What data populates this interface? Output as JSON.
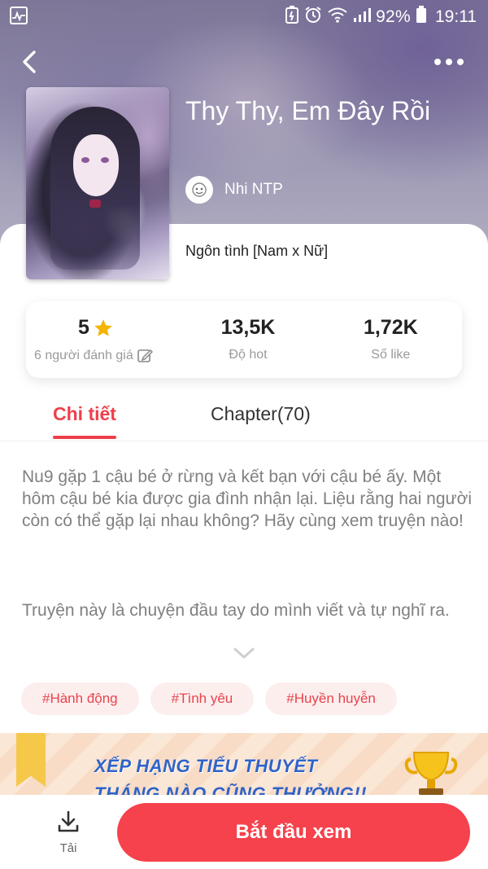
{
  "status_bar": {
    "battery_percent": "92%",
    "time": "19:11"
  },
  "book": {
    "title": "Thy Thy, Em Đây Rồi",
    "author": "Nhi NTP",
    "genre": "Ngôn tình [Nam x Nữ]"
  },
  "stats": {
    "rating_value": "5",
    "rating_label": "6 người đánh giá",
    "hot_value": "13,5K",
    "hot_label": "Độ hot",
    "likes_value": "1,72K",
    "likes_label": "Số like"
  },
  "tabs": {
    "detail": "Chi tiết",
    "chapter": "Chapter(70)"
  },
  "description": {
    "paragraph_1": "Nu9 gặp 1 cậu bé ở rừng và kết bạn với cậu bé ấy. Một hôm cậu bé kia được gia đình nhận lại. Liệu rằng hai người còn có thể gặp lại nhau không? Hãy cùng xem truyện nào!",
    "paragraph_2": "Truyện này là chuyện đầu tay do mình viết và tự nghĩ ra."
  },
  "tags": [
    "#Hành động",
    "#Tình yêu",
    "#Huyền huyễn"
  ],
  "banner": {
    "line_1": "XẾP HẠNG TIỂU THUYẾT",
    "line_2": "THÁNG NÀO CŨNG THƯỞNG!!"
  },
  "bottom_bar": {
    "download_label": "Tải",
    "start_button": "Bắt đầu xem"
  },
  "colors": {
    "accent": "#f5424c",
    "tag_bg": "#fdeeee",
    "star": "#f5b400"
  },
  "icons": {
    "back": "chevron-left-icon",
    "more": "more-dots-icon",
    "star": "star-icon",
    "edit": "edit-icon",
    "expand": "chevron-down-icon",
    "download": "download-icon"
  }
}
